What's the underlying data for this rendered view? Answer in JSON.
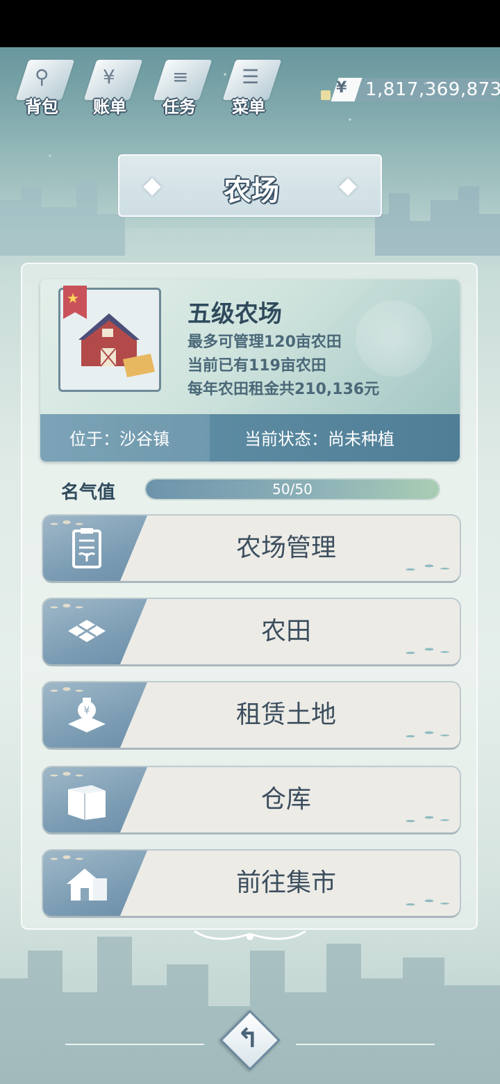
{
  "nav": {
    "items": [
      {
        "label": "背包",
        "icon": "bag-icon",
        "glyph": "⚲"
      },
      {
        "label": "账单",
        "icon": "bill-icon",
        "glyph": "¥"
      },
      {
        "label": "任务",
        "icon": "task-icon",
        "glyph": "≡"
      },
      {
        "label": "菜单",
        "icon": "menu-icon",
        "glyph": "☰"
      }
    ]
  },
  "money": {
    "symbol": "¥",
    "amount": "1,817,369,873"
  },
  "title": "农场",
  "farm": {
    "level_title": "五级农场",
    "line1": "最多可管理120亩农田",
    "line2": "当前已有119亩农田",
    "line3": "每年农田租金共210,136元",
    "location": "位于：沙谷镇",
    "status": "当前状态：尚未种植"
  },
  "fame": {
    "label": "名气值",
    "value": 50,
    "max": 50,
    "text": "50/50"
  },
  "menu": [
    {
      "label": "农场管理",
      "icon": "clipboard-icon"
    },
    {
      "label": "农田",
      "icon": "field-icon"
    },
    {
      "label": "租赁土地",
      "icon": "money-bag-icon"
    },
    {
      "label": "仓库",
      "icon": "box-icon"
    },
    {
      "label": "前往集市",
      "icon": "house-icon"
    }
  ],
  "back": {
    "glyph": "↰"
  },
  "colors": {
    "accent": "#6a97ad",
    "text_dark": "#2f4a5c",
    "button_bg": "#ecebe6"
  }
}
